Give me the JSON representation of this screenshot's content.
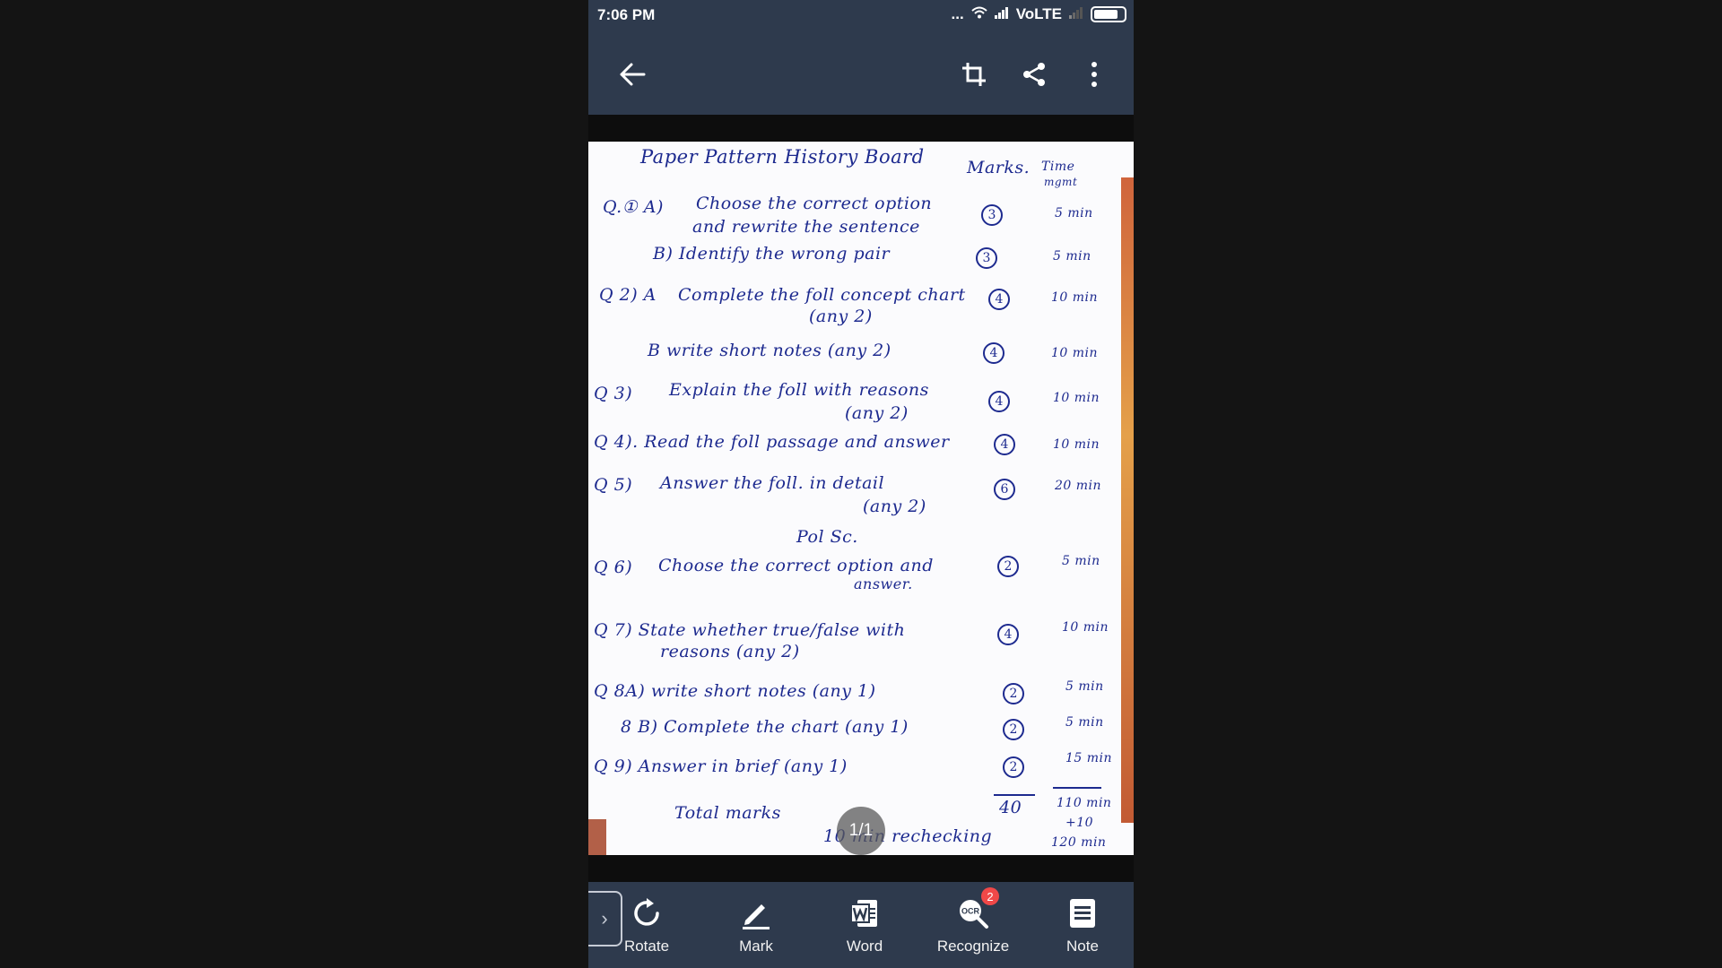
{
  "status_bar": {
    "time": "7:06 PM",
    "dots": "...",
    "network": "VoLTE"
  },
  "toolbar": {
    "back_icon": "arrow-left-icon",
    "crop_icon": "crop-icon",
    "share_icon": "share-icon",
    "menu_icon": "more-vertical-icon"
  },
  "document": {
    "lines": [
      {
        "id": "title",
        "text": "Paper Pattern History Board"
      },
      {
        "id": "h_marks",
        "text": "Marks."
      },
      {
        "id": "h_time",
        "text": "Time"
      },
      {
        "id": "h_mgmt",
        "text": "mgmt"
      },
      {
        "id": "q1a_num",
        "text": "Q.① A)"
      },
      {
        "id": "q1a_1",
        "text": "Choose the correct option"
      },
      {
        "id": "q1a_2",
        "text": "and rewrite the sentence"
      },
      {
        "id": "q1a_m",
        "text": "3"
      },
      {
        "id": "q1a_t",
        "text": "5 min"
      },
      {
        "id": "q1b",
        "text": "B) Identify the wrong pair"
      },
      {
        "id": "q1b_m",
        "text": "3"
      },
      {
        "id": "q1b_t",
        "text": "5 min"
      },
      {
        "id": "q2a_num",
        "text": "Q 2) A"
      },
      {
        "id": "q2a_1",
        "text": "Complete the foll concept chart"
      },
      {
        "id": "q2a_2",
        "text": "(any 2)"
      },
      {
        "id": "q2a_m",
        "text": "4"
      },
      {
        "id": "q2a_t",
        "text": "10 min"
      },
      {
        "id": "q2b",
        "text": "B write short notes (any 2)"
      },
      {
        "id": "q2b_m",
        "text": "4"
      },
      {
        "id": "q2b_t",
        "text": "10 min"
      },
      {
        "id": "q3_num",
        "text": "Q 3)"
      },
      {
        "id": "q3_1",
        "text": "Explain the foll with reasons"
      },
      {
        "id": "q3_2",
        "text": "(any 2)"
      },
      {
        "id": "q3_m",
        "text": "4"
      },
      {
        "id": "q3_t",
        "text": "10 min"
      },
      {
        "id": "q4",
        "text": "Q 4). Read the foll passage and answer"
      },
      {
        "id": "q4_m",
        "text": "4"
      },
      {
        "id": "q4_t",
        "text": "10 min"
      },
      {
        "id": "q5_num",
        "text": "Q 5)"
      },
      {
        "id": "q5_1",
        "text": "Answer the foll. in detail"
      },
      {
        "id": "q5_2",
        "text": "(any 2)"
      },
      {
        "id": "q5_m",
        "text": "6"
      },
      {
        "id": "q5_t",
        "text": "20 min"
      },
      {
        "id": "polsc",
        "text": "Pol Sc."
      },
      {
        "id": "q6_num",
        "text": "Q 6)"
      },
      {
        "id": "q6_1",
        "text": "Choose the correct option and"
      },
      {
        "id": "q6_2",
        "text": "answer."
      },
      {
        "id": "q6_m",
        "text": "2"
      },
      {
        "id": "q6_t",
        "text": "5 min"
      },
      {
        "id": "q7_1",
        "text": "Q 7) State whether true/false with"
      },
      {
        "id": "q7_2",
        "text": "reasons (any 2)"
      },
      {
        "id": "q7_m",
        "text": "4"
      },
      {
        "id": "q7_t",
        "text": "10 min"
      },
      {
        "id": "q8a",
        "text": "Q 8A) write short notes (any 1)"
      },
      {
        "id": "q8a_m",
        "text": "2"
      },
      {
        "id": "q8a_t",
        "text": "5 min"
      },
      {
        "id": "q8b",
        "text": "8 B) Complete the chart (any 1)"
      },
      {
        "id": "q8b_m",
        "text": "2"
      },
      {
        "id": "q8b_t",
        "text": "5 min"
      },
      {
        "id": "q9",
        "text": "Q 9) Answer in brief (any 1)"
      },
      {
        "id": "q9_m",
        "text": "2"
      },
      {
        "id": "q9_t",
        "text": "15 min"
      },
      {
        "id": "total",
        "text": "Total marks"
      },
      {
        "id": "total_m",
        "text": "40"
      },
      {
        "id": "total_t",
        "text": "110 min"
      },
      {
        "id": "recheck",
        "text": "10 min rechecking"
      },
      {
        "id": "plus10",
        "text": "+10"
      },
      {
        "id": "grand_t",
        "text": "120 min"
      }
    ]
  },
  "page_indicator": "1/1",
  "bottom_bar": {
    "items": [
      {
        "label": "Rotate",
        "icon": "rotate-icon"
      },
      {
        "label": "Mark",
        "icon": "pen-icon"
      },
      {
        "label": "Word",
        "icon": "word-doc-icon"
      },
      {
        "label": "Recognize",
        "icon": "ocr-icon",
        "badge": "2"
      },
      {
        "label": "Note",
        "icon": "note-icon"
      }
    ]
  }
}
